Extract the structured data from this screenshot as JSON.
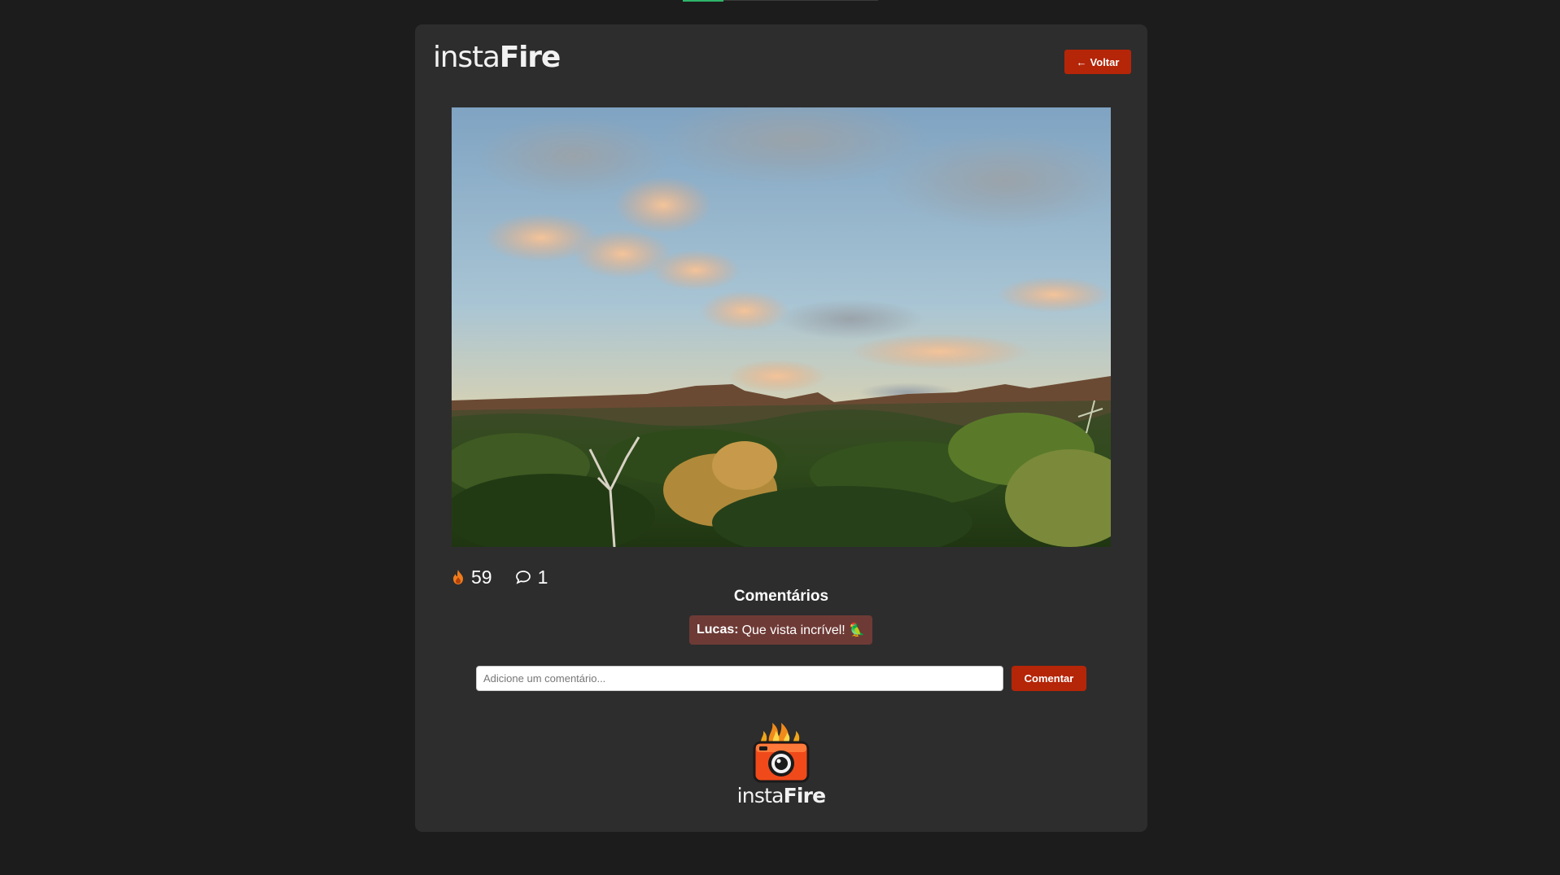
{
  "header": {
    "brand_part1": "insta",
    "brand_part2": "Fire",
    "back_button": {
      "arrow": "←",
      "label": "Voltar"
    }
  },
  "post": {
    "image_description_icon": "landscape-photo",
    "likes": "59",
    "comments_count": "1"
  },
  "comments": {
    "title": "Comentários",
    "items": [
      {
        "author": "Lucas:",
        "text": "Que vista incrível! 🦜"
      }
    ],
    "input_placeholder": "Adicione um comentário...",
    "submit_label": "Comentar"
  },
  "footer": {
    "brand_part1": "insta",
    "brand_part2": "Fire"
  },
  "colors": {
    "background": "#1c1c1c",
    "card": "#2d2d2d",
    "accent": "#b52508",
    "comment_bubble": "#6e3a36",
    "fire_icon": "#f07c1b"
  }
}
